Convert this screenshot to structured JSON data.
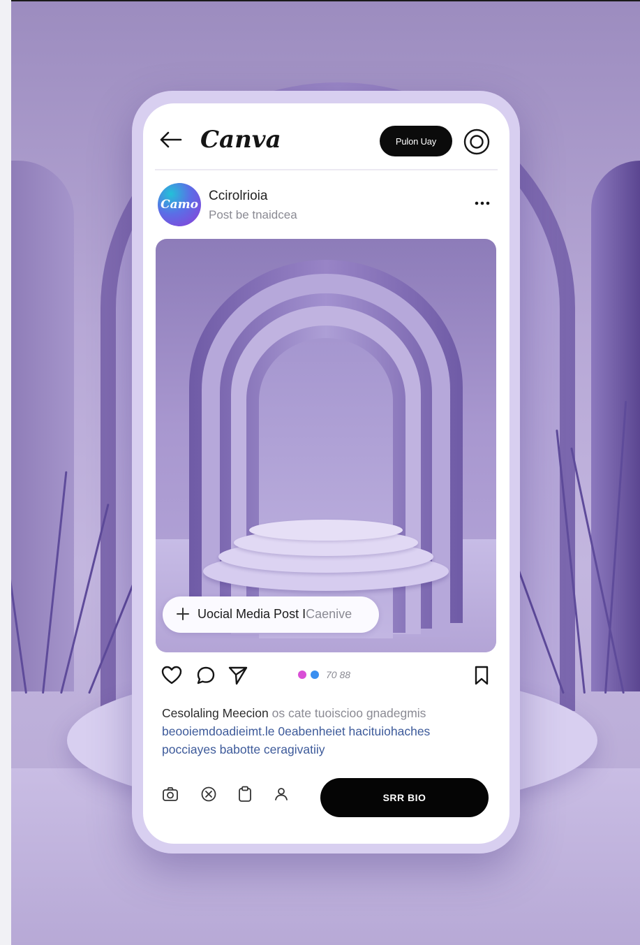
{
  "app": {
    "brand": "Canva",
    "publish_label": "Pulon Uay"
  },
  "post": {
    "avatar_text": "Camo",
    "account_name": "Ccirolrioia",
    "account_sub": "Post be tnaidcea",
    "tag_main": "Uocial Media Post I",
    "tag_sub": "Caenive",
    "reaction_count": "70 88",
    "caption_line1_main": "Cesolaling Meecion",
    "caption_line1_light": "os cate tuoiscioo gnadegmis",
    "caption_line2": "beooiemdoadieimt.le 0eabenheiet hacituiohaches",
    "caption_line3": "pocciayes babotte ceragivatiiy"
  },
  "footer": {
    "share_label": "SRR BIO"
  },
  "icons": {
    "back": "arrow-left-icon",
    "profile": "circle-target-icon",
    "more": "more-dots-icon",
    "like": "heart-icon",
    "comment": "comment-bubble-icon",
    "send": "send-icon",
    "save": "bookmark-icon",
    "camera": "camera-icon",
    "cancel": "circle-x-icon",
    "clipboard": "clipboard-icon",
    "user": "user-icon",
    "add": "plus-icon"
  },
  "colors": {
    "accent_dark": "#0b0b0b",
    "dot_pink": "#d94fd6",
    "dot_blue": "#3a8ff0",
    "caption_blue": "#3d5a9a",
    "lavender": "#b7a8d6"
  }
}
